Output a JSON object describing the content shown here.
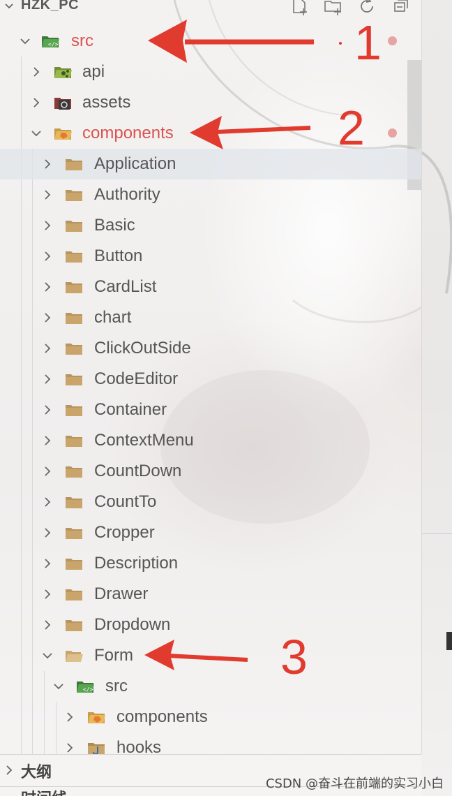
{
  "explorer": {
    "title": "HZK_PC",
    "toolbar_icons": [
      "new-file-icon",
      "new-folder-icon",
      "refresh-icon",
      "collapse-all-icon"
    ]
  },
  "tree": [
    {
      "label": "src",
      "depth": 0,
      "expanded": true,
      "icon": "src-folder-icon",
      "highlight": true
    },
    {
      "label": "api",
      "depth": 1,
      "expanded": false,
      "icon": "api-folder-icon",
      "highlight": false
    },
    {
      "label": "assets",
      "depth": 1,
      "expanded": false,
      "icon": "assets-folder-icon",
      "highlight": false
    },
    {
      "label": "components",
      "depth": 1,
      "expanded": true,
      "icon": "components-folder-icon",
      "highlight": true
    },
    {
      "label": "Application",
      "depth": 2,
      "expanded": false,
      "icon": "folder-icon",
      "selected": true
    },
    {
      "label": "Authority",
      "depth": 2,
      "expanded": false,
      "icon": "folder-icon"
    },
    {
      "label": "Basic",
      "depth": 2,
      "expanded": false,
      "icon": "folder-icon"
    },
    {
      "label": "Button",
      "depth": 2,
      "expanded": false,
      "icon": "folder-icon"
    },
    {
      "label": "CardList",
      "depth": 2,
      "expanded": false,
      "icon": "folder-icon"
    },
    {
      "label": "chart",
      "depth": 2,
      "expanded": false,
      "icon": "folder-icon"
    },
    {
      "label": "ClickOutSide",
      "depth": 2,
      "expanded": false,
      "icon": "folder-icon"
    },
    {
      "label": "CodeEditor",
      "depth": 2,
      "expanded": false,
      "icon": "folder-icon"
    },
    {
      "label": "Container",
      "depth": 2,
      "expanded": false,
      "icon": "folder-icon"
    },
    {
      "label": "ContextMenu",
      "depth": 2,
      "expanded": false,
      "icon": "folder-icon"
    },
    {
      "label": "CountDown",
      "depth": 2,
      "expanded": false,
      "icon": "folder-icon"
    },
    {
      "label": "CountTo",
      "depth": 2,
      "expanded": false,
      "icon": "folder-icon"
    },
    {
      "label": "Cropper",
      "depth": 2,
      "expanded": false,
      "icon": "folder-icon"
    },
    {
      "label": "Description",
      "depth": 2,
      "expanded": false,
      "icon": "folder-icon"
    },
    {
      "label": "Drawer",
      "depth": 2,
      "expanded": false,
      "icon": "folder-icon"
    },
    {
      "label": "Dropdown",
      "depth": 2,
      "expanded": false,
      "icon": "folder-icon"
    },
    {
      "label": "Form",
      "depth": 2,
      "expanded": true,
      "icon": "open-folder-icon"
    },
    {
      "label": "src",
      "depth": 3,
      "expanded": true,
      "icon": "src-folder-icon"
    },
    {
      "label": "components",
      "depth": 4,
      "expanded": false,
      "icon": "components-folder-icon"
    },
    {
      "label": "hooks",
      "depth": 4,
      "expanded": false,
      "icon": "hooks-folder-icon"
    }
  ],
  "annotations": {
    "num1": "1",
    "num2": "2",
    "num3": "3"
  },
  "bottom": {
    "outline_label": "大纲",
    "timeline_label": "时间线"
  },
  "watermark": "CSDN @奋斗在前端的实习小白",
  "colors": {
    "highlight_red": "#d9534f",
    "annotation_red": "#e13a2e",
    "folder": "#c7a46a",
    "selected_row": "#e0e4ea"
  }
}
